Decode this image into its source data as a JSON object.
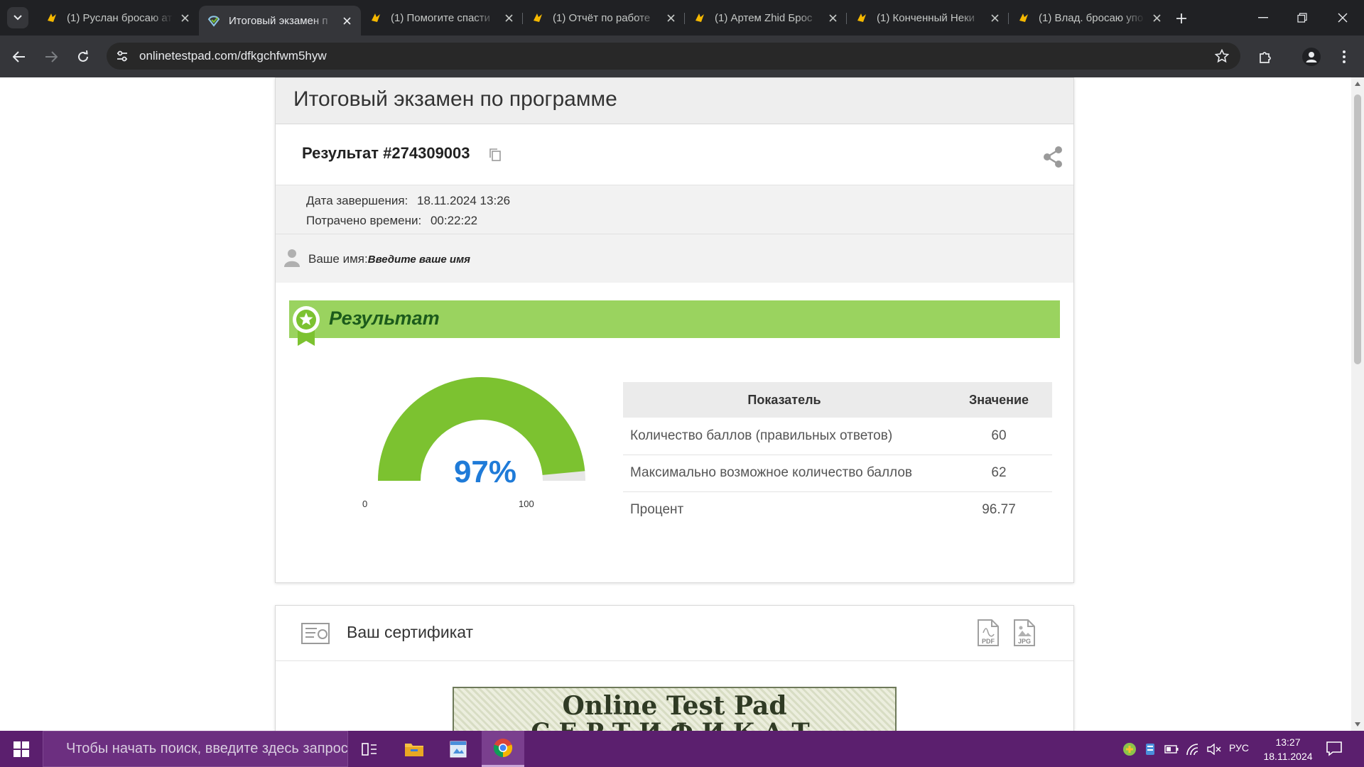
{
  "browser": {
    "tabs": [
      {
        "title": "(1) Руслан бросаю ат",
        "icon": "zaycev-favicon",
        "active": false
      },
      {
        "title": "Итоговый экзамен п",
        "icon": "onlinetestpad-favicon",
        "active": true
      },
      {
        "title": "(1) Помогите спасти",
        "icon": "zaycev-favicon",
        "active": false
      },
      {
        "title": "(1) Отчёт по работе",
        "icon": "zaycev-favicon",
        "active": false
      },
      {
        "title": "(1) Артем Zhid Брос",
        "icon": "zaycev-favicon",
        "active": false
      },
      {
        "title": "(1) Конченный Неки",
        "icon": "zaycev-favicon",
        "active": false
      },
      {
        "title": "(1) Влад. бросаю упо",
        "icon": "zaycev-favicon",
        "active": false
      }
    ],
    "url": "onlinetestpad.com/dfkgchfwm5hyw"
  },
  "page": {
    "title": "Итоговый экзамен по программе",
    "result_title": "Результат #274309003",
    "completed_label": "Дата завершения:",
    "completed_value": "18.11.2024 13:26",
    "time_label": "Потрачено времени:",
    "time_value": "00:22:22",
    "name_label": "Ваше имя:",
    "name_placeholder": "Введите ваше имя",
    "banner_title": "Результат",
    "gauge": {
      "percent": 97,
      "percent_label": "97%",
      "min": "0",
      "max": "100"
    },
    "table": {
      "headers": [
        "Показатель",
        "Значение"
      ],
      "rows": [
        {
          "label": "Количество баллов (правильных ответов)",
          "value": "60"
        },
        {
          "label": "Максимально возможное количество баллов",
          "value": "62"
        },
        {
          "label": "Процент",
          "value": "96.77"
        }
      ]
    },
    "certificate": {
      "title": "Ваш сертификат",
      "pdf_label": "PDF",
      "jpg_label": "JPG",
      "brand": "Online Test Pad",
      "sub": "СЕРТИФИКАТ"
    }
  },
  "taskbar": {
    "search_placeholder": "Чтобы начать поиск, введите здесь запрос",
    "lang": "РУС",
    "time": "13:27",
    "date": "18.11.2024"
  },
  "colors": {
    "accent_green": "#7cc230",
    "banner_green": "#9ad35f",
    "gauge_blue": "#1f7bd8",
    "taskbar": "#5b1f6e"
  }
}
